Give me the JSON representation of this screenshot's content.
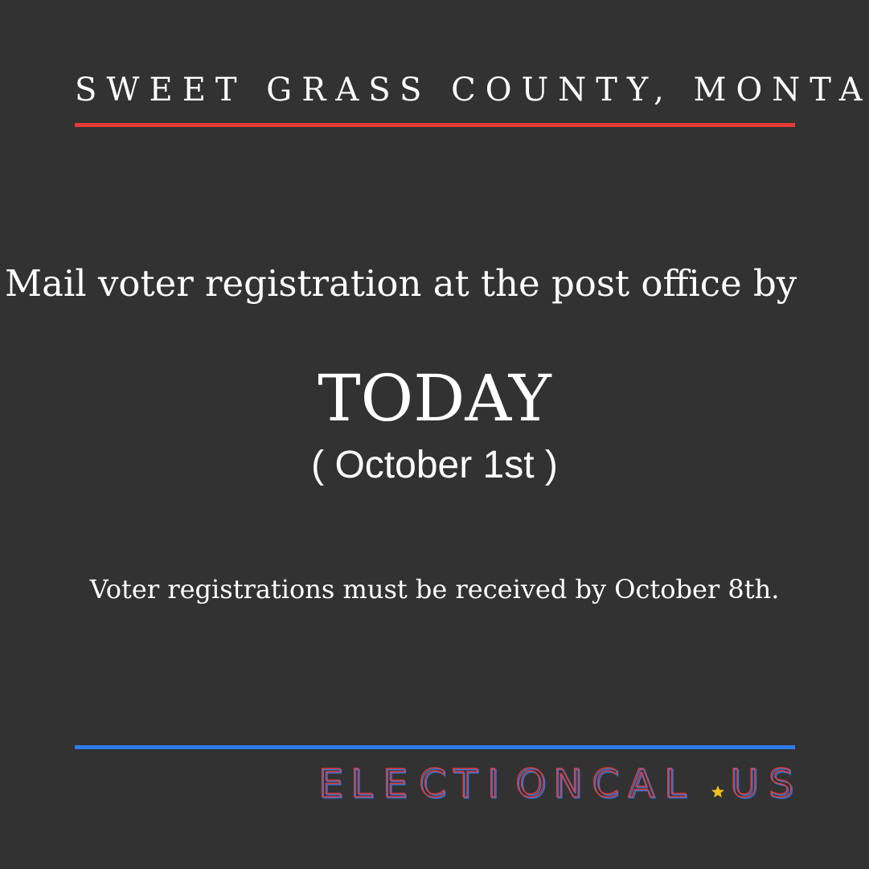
{
  "header": {
    "county": "SWEET GRASS COUNTY, MONTANA"
  },
  "message": {
    "headline": "Mail voter registration at the post office by",
    "deadline": "TODAY",
    "deadline_date": "( October 1st )",
    "note": "Voter registrations must be received by October 8th."
  },
  "branding": {
    "logo_text": "ELECTIONCAL.US",
    "logo_letters": [
      "E",
      "L",
      "E",
      "C",
      "T",
      "I",
      "O",
      "N",
      "C",
      "A",
      "L",
      "U",
      "S"
    ],
    "star_icon": "star-icon"
  },
  "colors": {
    "background": "#323232",
    "accent_red": "#e63b37",
    "accent_blue": "#2e7be8",
    "star_yellow": "#f2c21b",
    "text": "#ffffff"
  }
}
